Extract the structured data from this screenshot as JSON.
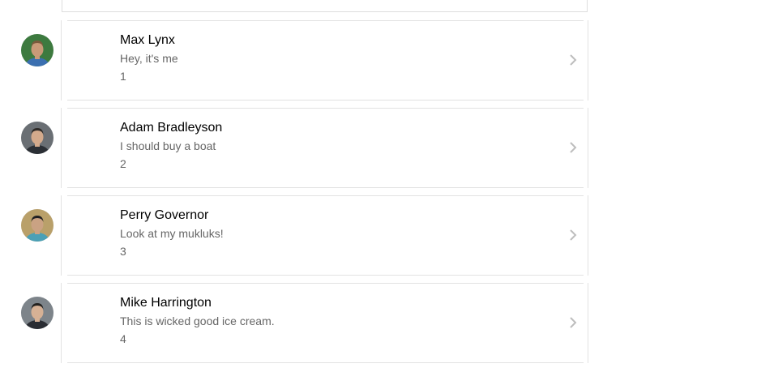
{
  "contacts": [
    {
      "name": "Max Lynx",
      "message": "Hey, it's me",
      "count": "1",
      "avatar": {
        "bg": "#3d7a3f",
        "skin": "#c99a78",
        "hair": "#7a5a3c",
        "shirt": "#3b6fb0",
        "icon": "person-avatar-icon"
      }
    },
    {
      "name": "Adam Bradleyson",
      "message": "I should buy a boat",
      "count": "2",
      "avatar": {
        "bg": "#6a6f74",
        "skin": "#d3aa8c",
        "hair": "#2e2a27",
        "shirt": "#2b2f35",
        "icon": "person-avatar-icon"
      }
    },
    {
      "name": "Perry Governor",
      "message": "Look at my mukluks!",
      "count": "3",
      "avatar": {
        "bg": "#b9a06a",
        "skin": "#caa283",
        "hair": "#1f1f22",
        "shirt": "#4aa0b6",
        "icon": "person-avatar-icon"
      }
    },
    {
      "name": "Mike Harrington",
      "message": "This is wicked good ice cream.",
      "count": "4",
      "avatar": {
        "bg": "#7d848a",
        "skin": "#d6b195",
        "hair": "#23211f",
        "shirt": "#2a2d33",
        "icon": "person-avatar-icon"
      }
    }
  ],
  "colors": {
    "border": "#e2e2e2",
    "chevron": "#bdbdbd",
    "name": "#000000",
    "secondary": "#666666"
  },
  "icons": {
    "chevron": "chevron-right-icon"
  }
}
